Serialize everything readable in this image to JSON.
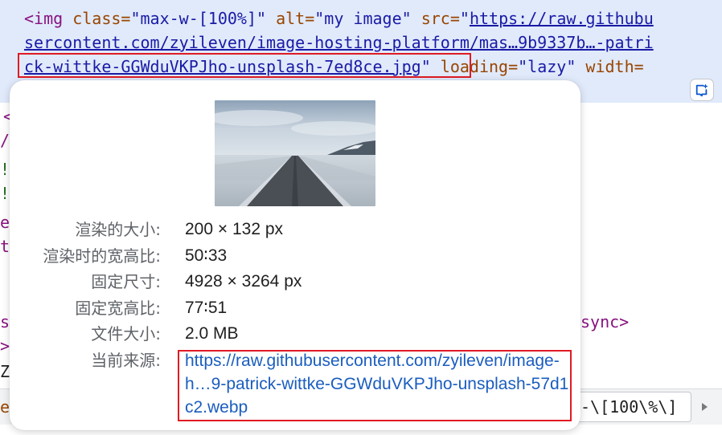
{
  "code": {
    "line1": {
      "open": "<img",
      "attr_class": " class=",
      "val_class": "\"max-w-[100%]\"",
      "attr_alt": " alt=",
      "val_alt": "\"my image\"",
      "attr_src": " src=",
      "quote": "\"",
      "src_part1": "https://raw.githubu"
    },
    "line2": {
      "src_part2": "sercontent.com/zyileven/image-hosting-platform/mas…9b9337b…-patri"
    },
    "line3": {
      "src_part3": "ck-wittke-GGWduVKPJho-unsplash-7ed8ce.jpg",
      "quote": "\"",
      "attr_loading": " loading=",
      "val_loading": "\"lazy\"",
      "attr_width": " width="
    },
    "right_fragment": "sync>",
    "bottom_breadcrumb": "-\\[100\\%\\]",
    "bottom_left_char": "e"
  },
  "popover": {
    "rows": [
      {
        "label": "渲染的大小:",
        "value": "200 × 132 px"
      },
      {
        "label": "渲染时的宽高比:",
        "value": "50∶33"
      },
      {
        "label": "固定尺寸:",
        "value": "4928 × 3264 px"
      },
      {
        "label": "固定宽高比:",
        "value": "77∶51"
      },
      {
        "label": "文件大小:",
        "value": "2.0 MB"
      }
    ],
    "source_label": "当前来源:",
    "source_url": "https://raw.githubusercontent.com/zyileven/image-h…9-patrick-wittke-GGWduVKPJho-unsplash-57d1c2.webp"
  },
  "colors": {
    "highlight_row": "#e0eafb",
    "annotation_red": "#e01b24",
    "link_blue": "#1a5dbf"
  },
  "icons": {
    "ai_assist": "sparkle-edit-icon",
    "scroll_right": "triangle-right-icon"
  }
}
